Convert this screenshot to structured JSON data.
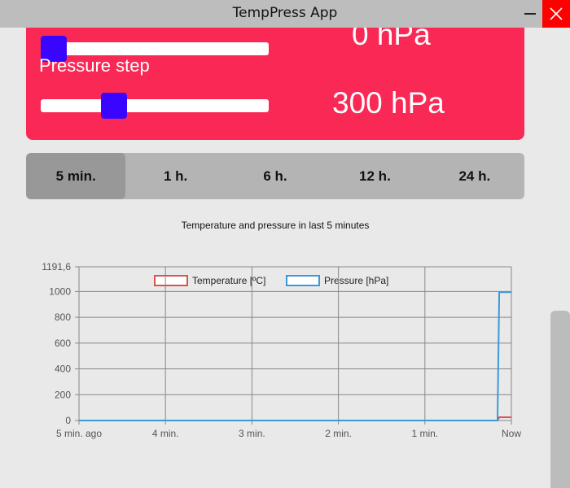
{
  "window": {
    "title": "TempPress App"
  },
  "settings": {
    "top_value": "0 hPa",
    "top_slider_fraction": 0.0,
    "step_label": "Pressure step",
    "step_value": "300 hPa",
    "step_slider_fraction": 0.3,
    "accent_color": "#fa2855",
    "thumb_color": "#3a05ff"
  },
  "tabs": [
    {
      "label": "5 min.",
      "active": true
    },
    {
      "label": "1 h.",
      "active": false
    },
    {
      "label": "6 h.",
      "active": false
    },
    {
      "label": "12 h.",
      "active": false
    },
    {
      "label": "24 h.",
      "active": false
    }
  ],
  "chart_data": {
    "type": "line",
    "title": "Temperature and pressure in last 5 minutes",
    "legend_position": "top",
    "grid": true,
    "x_ticks": [
      "5 min. ago",
      "4 min.",
      "3 min.",
      "2 min.",
      "1 min.",
      "Now"
    ],
    "y_ticks": [
      "1191,6",
      "1000",
      "800",
      "600",
      "400",
      "200",
      "0"
    ],
    "ylim": [
      0,
      1191.6
    ],
    "xlim": [
      -5,
      0
    ],
    "series": [
      {
        "name": "Temperature [ºC]",
        "color": "#d9534f",
        "points": [
          [
            -5,
            0
          ],
          [
            -0.16,
            0
          ],
          [
            -0.14,
            25
          ],
          [
            0,
            25
          ]
        ]
      },
      {
        "name": "Pressure [hPa]",
        "color": "#3a9ad9",
        "points": [
          [
            -5,
            0
          ],
          [
            -0.16,
            0
          ],
          [
            -0.14,
            995
          ],
          [
            0,
            995
          ]
        ]
      }
    ]
  }
}
